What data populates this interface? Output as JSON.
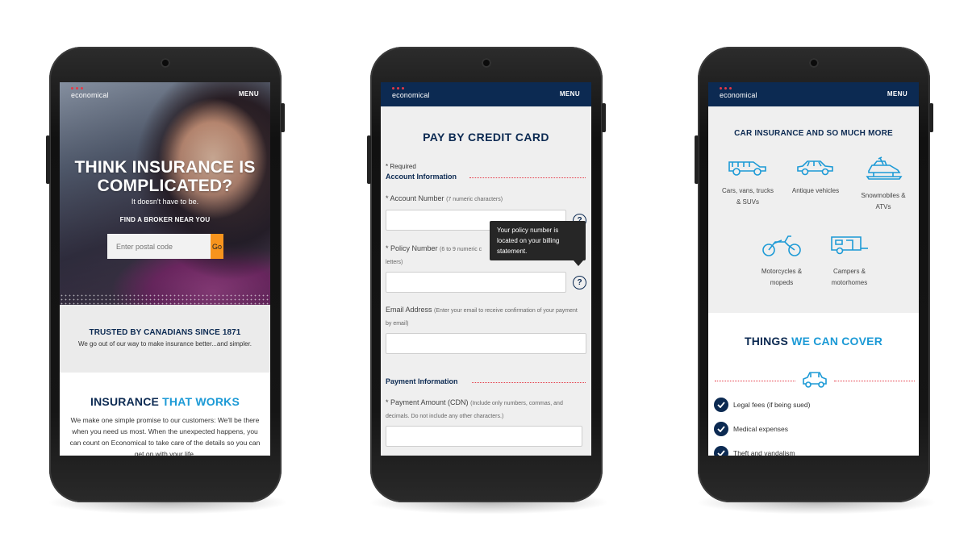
{
  "brand": {
    "logo_text": "economical",
    "menu_label": "MENU",
    "accent": "#0c2a52",
    "highlight": "#1c9ad6",
    "cta": "#f7941d",
    "dot": "#e53946"
  },
  "home": {
    "hero_title_line1": "THINK INSURANCE IS",
    "hero_title_line2": "COMPLICATED?",
    "hero_sub": "It doesn't have to be.",
    "find_label": "FIND A BROKER NEAR YOU",
    "postal_placeholder": "Enter postal code",
    "go_label": "Go",
    "trusted_title": "TRUSTED BY CANADIANS SINCE 1871",
    "trusted_text": "We go out of our way to make insurance better...and simpler.",
    "works_title_a": "INSURANCE ",
    "works_title_b": "THAT WORKS",
    "works_text": "We make one simple promise to our customers: We'll be there when you need us most. When the unexpected happens, you can count on Economical to take care of the details so you can get on with your life."
  },
  "payment": {
    "title": "PAY BY CREDIT CARD",
    "required": "* Required",
    "account_section": "Account Information",
    "account_label": "* Account Number",
    "account_hint": "(7 numeric characters)",
    "policy_label": "* Policy Number",
    "policy_hint": "(6 to 9 numeric c",
    "policy_hint2": "letters)",
    "tooltip": "Your policy number is located on your billing statement.",
    "email_label": "Email Address",
    "email_hint": "(Enter your email to receive confirmation of your payment by email)",
    "payment_section": "Payment Information",
    "amount_label": "* Payment Amount (CDN)",
    "amount_hint": "(Include only numbers, commas, and decimals. Do not include any other characters.)",
    "help_icon_glyph": "?"
  },
  "coverage": {
    "title": "CAR INSURANCE AND SO MUCH MORE",
    "vehicles": [
      {
        "icon": "suv-icon",
        "line1": "Cars, vans, trucks",
        "line2": "& SUVs"
      },
      {
        "icon": "antique-car-icon",
        "line1": "Antique vehicles",
        "line2": ""
      },
      {
        "icon": "snowmobile-icon",
        "line1": "Snowmobiles &",
        "line2": "ATVs"
      },
      {
        "icon": "motorcycle-icon",
        "line1": "Motorcycles &",
        "line2": "mopeds"
      },
      {
        "icon": "camper-icon",
        "line1": "Campers &",
        "line2": "motorhomes"
      }
    ],
    "cover_title_a": "THINGS ",
    "cover_title_b": "WE CAN COVER",
    "items": [
      "Legal fees (if being sued)",
      "Medical expenses",
      "Theft and vandalism"
    ]
  }
}
